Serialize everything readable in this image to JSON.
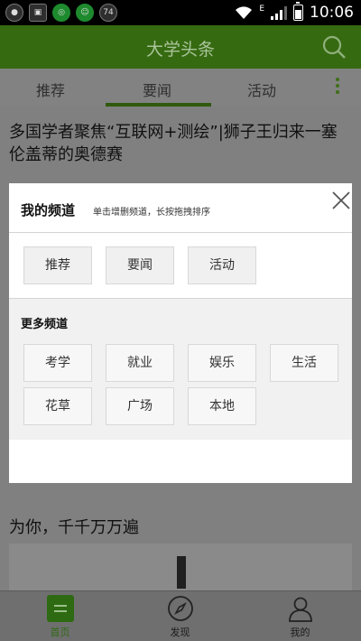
{
  "status_bar": {
    "time": "10:06",
    "network_type": "E",
    "notification_badge": "74"
  },
  "app": {
    "title": "大学头条"
  },
  "tabs": [
    {
      "label": "推荐"
    },
    {
      "label": "要闻"
    },
    {
      "label": "活动"
    }
  ],
  "feed": {
    "article_1_title": "多国学者聚焦“互联网+测绘”|狮子王归来一塞伦盖蒂的奥德赛",
    "article_2_title": "为你，千千万万遍"
  },
  "modal": {
    "title": "我的频道",
    "hint": "单击增删频道，长按拖拽排序",
    "my_channels": [
      "推荐",
      "要闻",
      "活动"
    ],
    "more_title": "更多频道",
    "more_channels": [
      "考学",
      "就业",
      "娱乐",
      "生活",
      "花草",
      "广场",
      "本地"
    ]
  },
  "bottom_nav": [
    {
      "label": "首页"
    },
    {
      "label": "发现"
    },
    {
      "label": "我的"
    }
  ],
  "colors": {
    "accent_green": "#3f8a1a",
    "overlay_dim": "#808080"
  }
}
